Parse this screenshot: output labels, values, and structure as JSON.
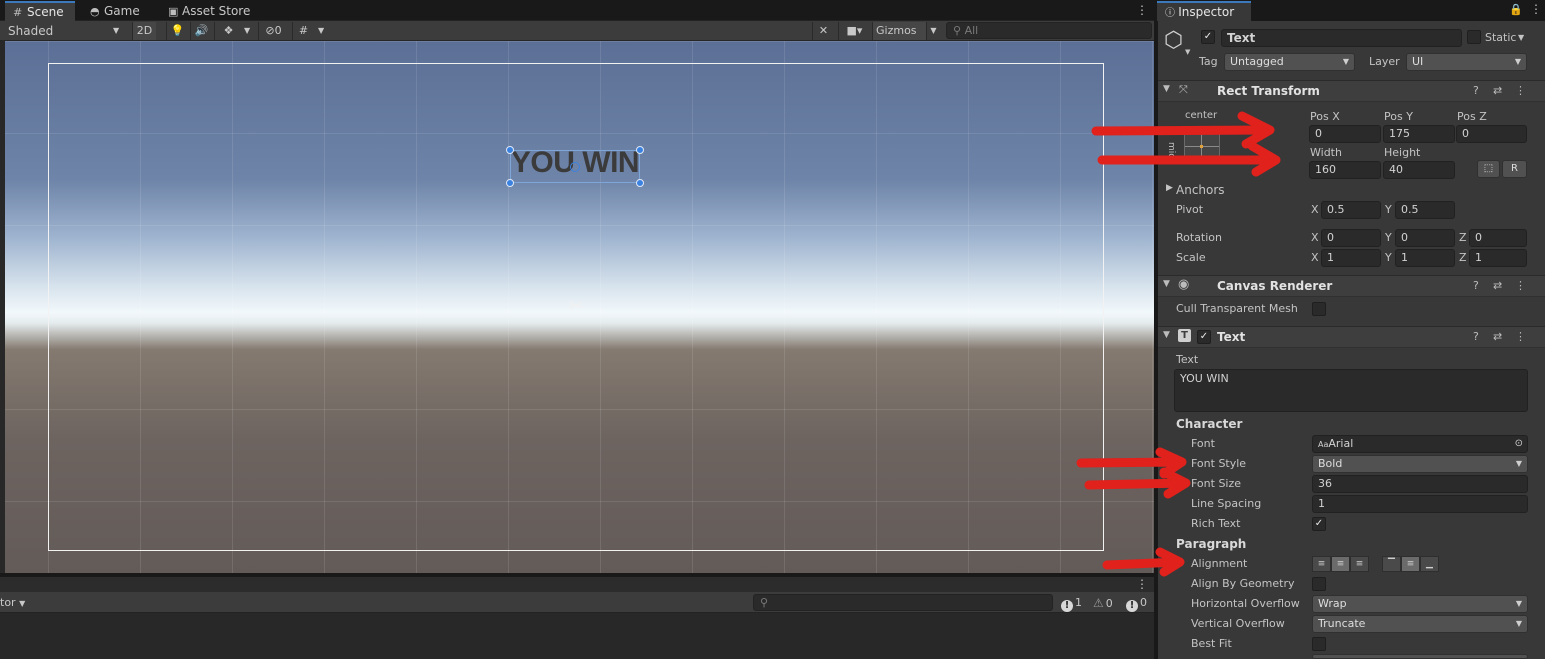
{
  "tabs": {
    "scene": "Scene",
    "game": "Game",
    "asset_store": "Asset Store",
    "scene_icon": "grid-icon",
    "game_icon": "gamepad-icon",
    "store_icon": "bag-icon"
  },
  "scene_toolbar": {
    "shading_mode": "Shaded",
    "toggle_2d": "2D",
    "hidden_count": "0",
    "gizmos": "Gizmos",
    "search_placeholder": "All"
  },
  "viewport": {
    "ui_text": "YOU WIN"
  },
  "console": {
    "filter_label": "tor",
    "log_count": "1",
    "warn_count": "0",
    "error_count": "0"
  },
  "inspector": {
    "tab_label": "Inspector",
    "object_name": "Text",
    "static_label": "Static",
    "tag_label": "Tag",
    "tag_value": "Untagged",
    "layer_label": "Layer",
    "layer_value": "UI",
    "rect_transform": {
      "title": "Rect Transform",
      "anchor_preset_top": "center",
      "anchor_preset_side": "middle",
      "pos_x_label": "Pos X",
      "pos_y_label": "Pos Y",
      "pos_z_label": "Pos Z",
      "pos_x": "0",
      "pos_y": "175",
      "pos_z": "0",
      "width_label": "Width",
      "height_label": "Height",
      "width": "160",
      "height": "40",
      "r_button": "R",
      "anchors_label": "Anchors",
      "pivot_label": "Pivot",
      "pivot_x": "0.5",
      "pivot_y": "0.5",
      "rotation_label": "Rotation",
      "rotation": [
        "0",
        "0",
        "0"
      ],
      "scale_label": "Scale",
      "scale": [
        "1",
        "1",
        "1"
      ],
      "axis_x": "X",
      "axis_y": "Y",
      "axis_z": "Z"
    },
    "canvas_renderer": {
      "title": "Canvas Renderer",
      "cull_label": "Cull Transparent Mesh"
    },
    "text_component": {
      "title": "Text",
      "text_label": "Text",
      "text_value": "YOU WIN",
      "character_label": "Character",
      "font_label": "Font",
      "font_value": "Arial",
      "font_style_label": "Font Style",
      "font_style_value": "Bold",
      "font_size_label": "Font Size",
      "font_size_value": "36",
      "line_spacing_label": "Line Spacing",
      "line_spacing_value": "1",
      "rich_text_label": "Rich Text",
      "paragraph_label": "Paragraph",
      "alignment_label": "Alignment",
      "align_by_geometry_label": "Align By Geometry",
      "h_overflow_label": "Horizontal Overflow",
      "h_overflow_value": "Wrap",
      "v_overflow_label": "Vertical Overflow",
      "v_overflow_value": "Truncate",
      "best_fit_label": "Best Fit"
    }
  },
  "colors": {
    "annotation_red": "#e0211c",
    "selection_blue": "#3b82e0",
    "tab_accent": "#3a79bb"
  }
}
